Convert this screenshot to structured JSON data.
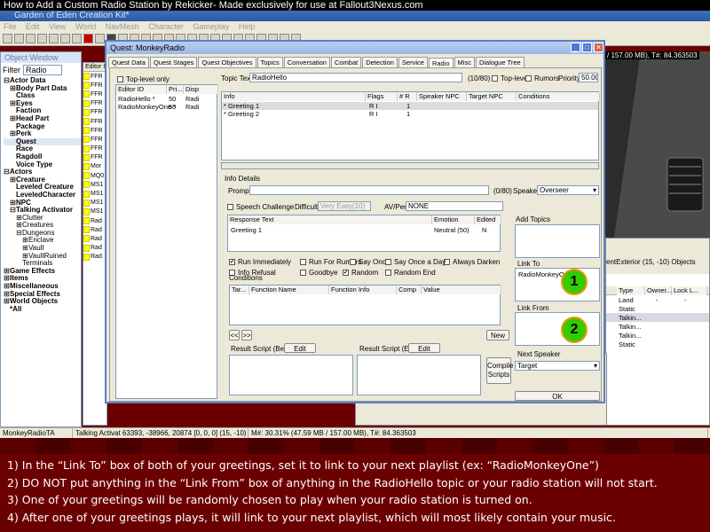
{
  "title_line": "How to Add a Custom Radio Station by Rekicker- Made exclusively for use at Fallout3Nexus.com",
  "app_title": "Garden of Eden Creation Kit*",
  "menu": [
    "File",
    "Edit",
    "View",
    "World",
    "NavMesh",
    "Character",
    "Gameplay",
    "Help"
  ],
  "object_window": {
    "title": "Object Window",
    "filter_label": "Filter",
    "filter_value": "Radio",
    "editor_id_col": "Editor I",
    "tree": [
      {
        "t": "Actor Data",
        "b": true,
        "lvl": 0,
        "e": "-"
      },
      {
        "t": "Body Part Data",
        "b": true,
        "lvl": 1,
        "e": "+"
      },
      {
        "t": "Class",
        "b": true,
        "lvl": 1
      },
      {
        "t": "Eyes",
        "b": true,
        "lvl": 1,
        "e": "+"
      },
      {
        "t": "Faction",
        "b": true,
        "lvl": 1
      },
      {
        "t": "Head Part",
        "b": true,
        "lvl": 1,
        "e": "+"
      },
      {
        "t": "Package",
        "b": true,
        "lvl": 1
      },
      {
        "t": "Perk",
        "b": true,
        "lvl": 1,
        "e": "+"
      },
      {
        "t": "Quest",
        "b": true,
        "lvl": 1,
        "sel": true
      },
      {
        "t": "Race",
        "b": true,
        "lvl": 1
      },
      {
        "t": "Ragdoll",
        "b": true,
        "lvl": 1
      },
      {
        "t": "Voice Type",
        "b": true,
        "lvl": 1
      },
      {
        "t": "Actors",
        "b": true,
        "lvl": 0,
        "e": "-"
      },
      {
        "t": "Creature",
        "b": true,
        "lvl": 1,
        "e": "+"
      },
      {
        "t": "Leveled Creature",
        "b": true,
        "lvl": 1
      },
      {
        "t": "LeveledCharacter",
        "b": true,
        "lvl": 1
      },
      {
        "t": "NPC",
        "b": true,
        "lvl": 1,
        "e": "+"
      },
      {
        "t": "Talking Activator",
        "b": true,
        "lvl": 1,
        "e": "-"
      },
      {
        "t": "Clutter",
        "b": false,
        "lvl": 2,
        "e": "+"
      },
      {
        "t": "Creatures",
        "b": false,
        "lvl": 2,
        "e": "+"
      },
      {
        "t": "Dungeons",
        "b": false,
        "lvl": 2,
        "e": "-"
      },
      {
        "t": "Enclave",
        "b": false,
        "lvl": 3,
        "e": "+"
      },
      {
        "t": "Vault",
        "b": false,
        "lvl": 3,
        "e": "+"
      },
      {
        "t": "VaultRuined",
        "b": false,
        "lvl": 3,
        "e": "+"
      },
      {
        "t": "Terminals",
        "b": false,
        "lvl": 2
      },
      {
        "t": "Game Effects",
        "b": true,
        "lvl": 0,
        "e": "+"
      },
      {
        "t": "Items",
        "b": true,
        "lvl": 0,
        "e": "+"
      },
      {
        "t": "Miscellaneous",
        "b": true,
        "lvl": 0,
        "e": "+"
      },
      {
        "t": "Special Effects",
        "b": true,
        "lvl": 0,
        "e": "+"
      },
      {
        "t": "World Objects",
        "b": true,
        "lvl": 0,
        "e": "+"
      },
      {
        "t": "*All",
        "b": true,
        "lvl": 0
      }
    ],
    "list_items": [
      "FFR",
      "FFR",
      "FFR",
      "FFR",
      "FFR",
      "FFR",
      "FFR",
      "FFR",
      "FFR",
      "FFR",
      "Mor",
      "MQ0",
      "MS1",
      "MS1",
      "MS1",
      "MS1",
      "Rad",
      "Rad",
      "Rad",
      "Rad",
      "Rad"
    ]
  },
  "dialog": {
    "title": "Quest: MonkeyRadio",
    "tabs": [
      "Quest Data",
      "Quest Stages",
      "Quest Objectives",
      "Topics",
      "Conversation",
      "Combat",
      "Detection",
      "Service",
      "Radio",
      "Misc",
      "Dialogue Tree"
    ],
    "active_tab": "Radio",
    "toplevel_only": "Top-level only",
    "topic_cols": [
      "Editor ID",
      "Pri...",
      "Disp"
    ],
    "topics": [
      {
        "id": "RadioHello *",
        "pri": "50",
        "disp": "Radi"
      },
      {
        "id": "RadioMonkeyOne *",
        "pri": "50",
        "disp": "Radi"
      }
    ],
    "topic_text_label": "Topic Text",
    "topic_text": "RadioHello",
    "topic_count": "(10/80)",
    "top_level": "Top-level",
    "rumors": "Rumors",
    "priority_label": "Priority",
    "priority": "50.00",
    "info_cols": [
      "Info",
      "Flags",
      "# R",
      "Speaker NPC",
      "Target NPC",
      "Conditions"
    ],
    "infos": [
      {
        "info": "* Greeting 1",
        "flags": "R    I",
        "r": "1"
      },
      {
        "info": "* Greeting 2",
        "flags": "R    I",
        "r": "1"
      }
    ],
    "info_details": "Info Details",
    "prompt_label": "Prompt",
    "prompt_count": "(0/80)",
    "speaker_label": "Speaker",
    "speaker": "Overseer",
    "speech_challenge": "Speech Challenge",
    "difficulty_label": "Difficulty",
    "difficulty": "Very Easy(10)",
    "avperk_label": "AV/Perk",
    "avperk": "NONE",
    "response_cols": [
      "Response Text",
      "Emotion",
      "Edited"
    ],
    "responses": [
      {
        "text": "Greeting 1",
        "emotion": "Neutral (50)",
        "edited": "N"
      }
    ],
    "add_topics": "Add Topics",
    "flags": [
      {
        "label": "Run Immediately",
        "checked": true
      },
      {
        "label": "Run For Rumors",
        "checked": false
      },
      {
        "label": "Say Once",
        "checked": false
      },
      {
        "label": "Always Darken",
        "checked": false
      },
      {
        "label": "Info Refusal",
        "checked": false
      },
      {
        "label": "Goodbye",
        "checked": false
      },
      {
        "label": "Random",
        "checked": true
      },
      {
        "label": "Say Once a Day",
        "checked": false
      },
      {
        "label": "Random End",
        "checked": false
      }
    ],
    "link_to_label": "Link To",
    "link_to_value": "RadioMonkeyOne *",
    "link_from_label": "Link From",
    "conditions_label": "Conditions",
    "cond_cols": [
      "Tar...",
      "Function Name",
      "Function Info",
      "Comp",
      "Value"
    ],
    "new_button": "New",
    "result_begin": "Result Script (Begin)",
    "result_end": "Result Script (End)",
    "edit_button": "Edit",
    "compile_scripts": "Compile Scripts",
    "next_speaker_label": "Next Speaker",
    "next_speaker": "Target",
    "ok_button": "OK",
    "nav_prev": "<<",
    "nav_next": ">>"
  },
  "markers": [
    "1",
    "2"
  ],
  "right_panel": {
    "memory": "/ 157.00 MB), T#: 84.363503",
    "cell_label": "entExterior (15, -10) Objects",
    "cols": [
      "Type",
      "Owner...",
      "Lock L..."
    ],
    "rows": [
      {
        "type": "Land",
        "owner": "-",
        "lock": "-"
      },
      {
        "type": "Static",
        "owner": "",
        "lock": ""
      },
      {
        "type": "Talkin...",
        "owner": "",
        "lock": ""
      },
      {
        "type": "Talkin...",
        "owner": "",
        "lock": ""
      },
      {
        "type": "Talkin...",
        "owner": "",
        "lock": ""
      },
      {
        "type": "Static",
        "owner": "",
        "lock": ""
      }
    ]
  },
  "status": {
    "left": "MonkeyRadioTA",
    "middle": "Talking Activat 63393, -38966, 20874 [0, 0, 0] (15, -10)",
    "right": "M#: 30.31% (47.59 MB / 157.00 MB), T#: 84.363503"
  },
  "instructions": [
    "1) In the “Link To” box of both of your greetings, set it to link to your next playlist (ex: “RadioMonkeyOne”)",
    "2) DO NOT put anything in the “Link From” box of anything in the RadioHello topic or your radio station will not start.",
    "3) One of your greetings will be randomly chosen to play when your radio station is turned on.",
    "4) After one of your greetings plays, it will link to your next playlist, which will most likely contain your music."
  ]
}
